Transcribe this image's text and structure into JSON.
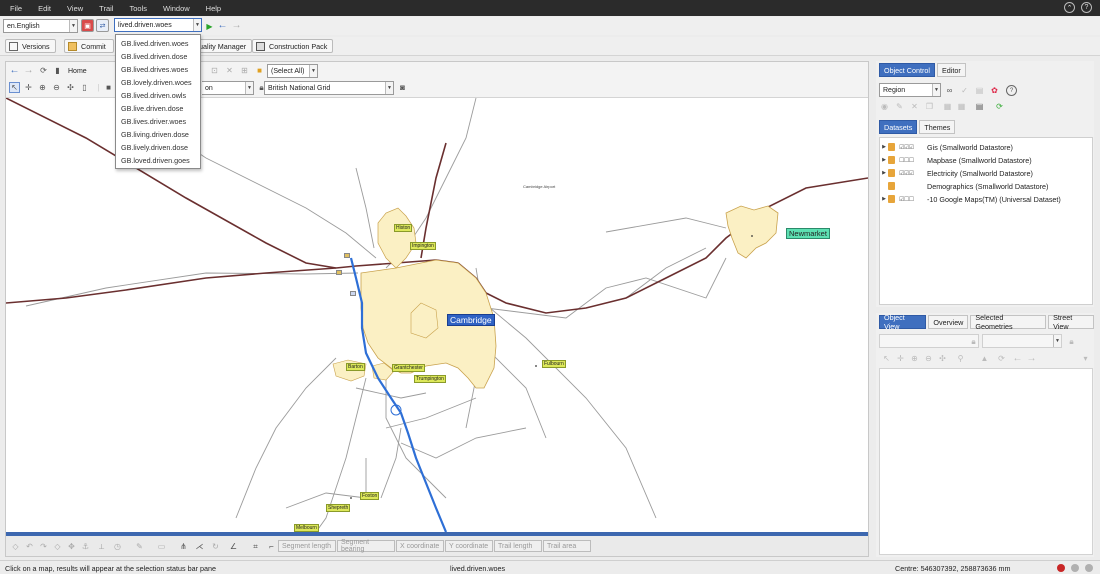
{
  "menu": [
    "File",
    "Edit",
    "View",
    "Trail",
    "Tools",
    "Window",
    "Help"
  ],
  "topbar": {
    "language": "en.English",
    "alternative": "lived.driven.woes"
  },
  "alt_dropdown_options": [
    "GB.lived.driven.woes",
    "GB.lived.driven.dose",
    "GB.lived.drives.woes",
    "GB.lovely.driven.woes",
    "GB.lived.driven.owls",
    "GB.live.driven.dose",
    "GB.lives.driver.woes",
    "GB.living.driven.dose",
    "GB.lively.driven.dose",
    "GB.loved.driven.goes"
  ],
  "toolbar": {
    "versions": "Versions",
    "commit": "Commit",
    "quality_manager": "uality Manager",
    "construction_pack": "Construction Pack"
  },
  "map": {
    "nav_home": "Home",
    "select_all": "(Select All)",
    "layer_partial": "on",
    "grid": "British National Grid",
    "labels": {
      "cambridge": "Cambridge",
      "newmarket": "Newmarket",
      "histon": "Histon",
      "impington": "Impington",
      "barton": "Barton",
      "grantchester": "Grantchester",
      "trumpington": "Trumpington",
      "fulbourn": "Fulbourn",
      "foxton": "Foxton",
      "shepreth": "Shepreth",
      "melbourn": "Melbourn",
      "cambridge_airport": "Cambridge Airport"
    }
  },
  "bottom_fields": [
    "Segment length",
    "Segment bearing",
    "X coordinate",
    "Y coordinate",
    "Trail length",
    "Trail area"
  ],
  "status": {
    "hint": "Click on a map, results will appear at the selection status bar pane",
    "alternative": "lived.driven.woes",
    "centre": "Centre: 546307392, 258873636 mm"
  },
  "right_panel": {
    "tabs": [
      "Object Control",
      "Editor"
    ],
    "region": "Region",
    "subtabs": [
      "Datasets",
      "Themes"
    ],
    "datasets": [
      {
        "name": "Gis (Smallworld Datastore)",
        "checks": "☑☑☑",
        "expand": true
      },
      {
        "name": "Mapbase (Smallworld Datastore)",
        "checks": "☐☐☐",
        "expand": true
      },
      {
        "name": "Electricity (Smallworld Datastore)",
        "checks": "☑☑☑",
        "expand": true
      },
      {
        "name": "Demographics (Smallworld Datastore)",
        "checks": "",
        "expand": false
      },
      {
        "name": "-10 Google Maps(TM) (Universal Dataset)",
        "checks": "☑☐☐",
        "expand": true
      }
    ]
  },
  "object_view": {
    "tabs": [
      "Object View",
      "Overview",
      "Selected Geometries",
      "Street View"
    ]
  },
  "colors": {
    "accent": "#3f6fbf",
    "city_fill": "#fbf0c4",
    "city_stroke": "#c9a24d",
    "railway": "#6a2f2f",
    "motorway": "#2e6fd6",
    "road": "#9b9b9b"
  }
}
